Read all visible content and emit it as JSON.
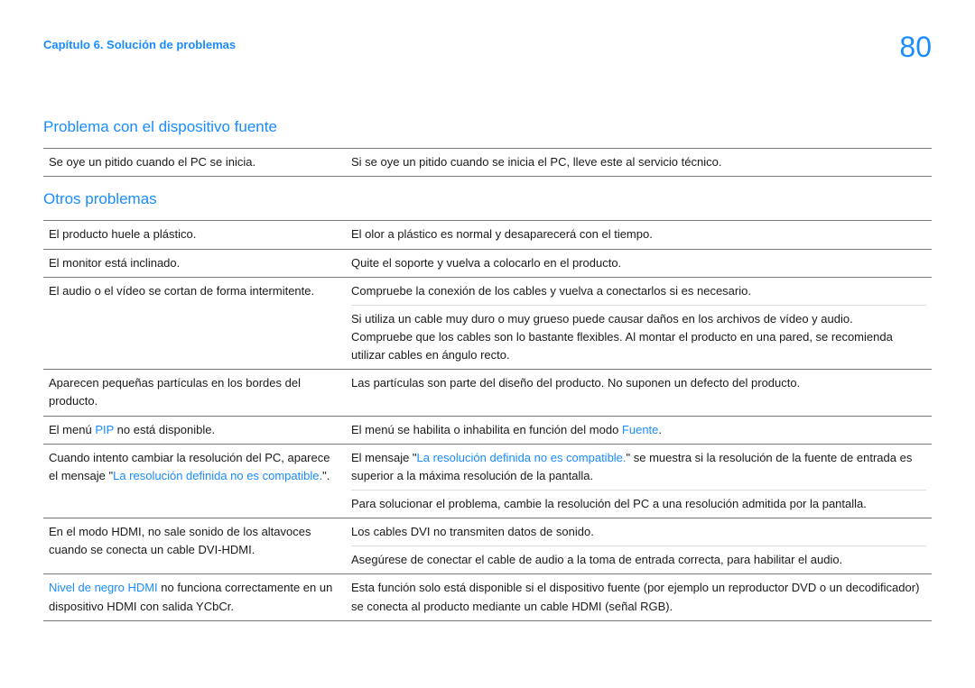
{
  "header": {
    "chapter": "Capítulo 6. Solución de problemas",
    "page_number": "80"
  },
  "sections": {
    "s1_title": "Problema con el dispositivo fuente",
    "s1_r1_left": "Se oye un pitido cuando el PC se inicia.",
    "s1_r1_right": "Si se oye un pitido cuando se inicia el PC, lleve este al servicio técnico.",
    "s2_title": "Otros problemas",
    "r1_left": "El producto huele a plástico.",
    "r1_right": "El olor a plástico es normal y desaparecerá con el tiempo.",
    "r2_left": "El monitor está inclinado.",
    "r2_right": "Quite el soporte y vuelva a colocarlo en el producto.",
    "r3_left": "El audio o el vídeo se cortan de forma intermitente.",
    "r3_right_a": "Compruebe la conexión de los cables y vuelva a conectarlos si es necesario.",
    "r3_right_b": "Si utiliza un cable muy duro o muy grueso puede causar daños en los archivos de vídeo y audio.",
    "r3_right_c": "Compruebe que los cables son lo bastante flexibles. Al montar el producto en una pared, se recomienda utilizar cables en ángulo recto.",
    "r4_left": "Aparecen pequeñas partículas en los bordes del producto.",
    "r4_right": "Las partículas son parte del diseño del producto. No suponen un defecto del producto.",
    "r5_left_a": "El menú ",
    "r5_left_pip": "PIP",
    "r5_left_b": " no está disponible.",
    "r5_right_a": "El menú se habilita o inhabilita en función del modo ",
    "r5_right_fuente": "Fuente",
    "r5_right_b": ".",
    "r6_left_a": "Cuando intento cambiar la resolución del PC, aparece el mensaje \"",
    "r6_left_msg": "La resolución definida no es compatible.",
    "r6_left_b": "\".",
    "r6_right_a1": "El mensaje \"",
    "r6_right_msg": "La resolución definida no es compatible.",
    "r6_right_a2": "\" se muestra si la resolución de la fuente de entrada es superior a la máxima resolución de la pantalla.",
    "r6_right_b": "Para solucionar el problema, cambie la resolución del PC a una resolución admitida por la pantalla.",
    "r7_left": "En el modo HDMI, no sale sonido de los altavoces cuando se conecta un cable DVI-HDMI.",
    "r7_right_a": "Los cables DVI no transmiten datos de sonido.",
    "r7_right_b": "Asegúrese de conectar el cable de audio a la toma de entrada correcta, para habilitar el audio.",
    "r8_left_a": "Nivel de negro HDMI",
    "r8_left_b": " no funciona correctamente en un dispositivo HDMI con salida YCbCr.",
    "r8_right": "Esta función solo está disponible si el dispositivo fuente (por ejemplo un reproductor DVD o un decodificador) se conecta al producto mediante un cable HDMI (señal RGB)."
  }
}
